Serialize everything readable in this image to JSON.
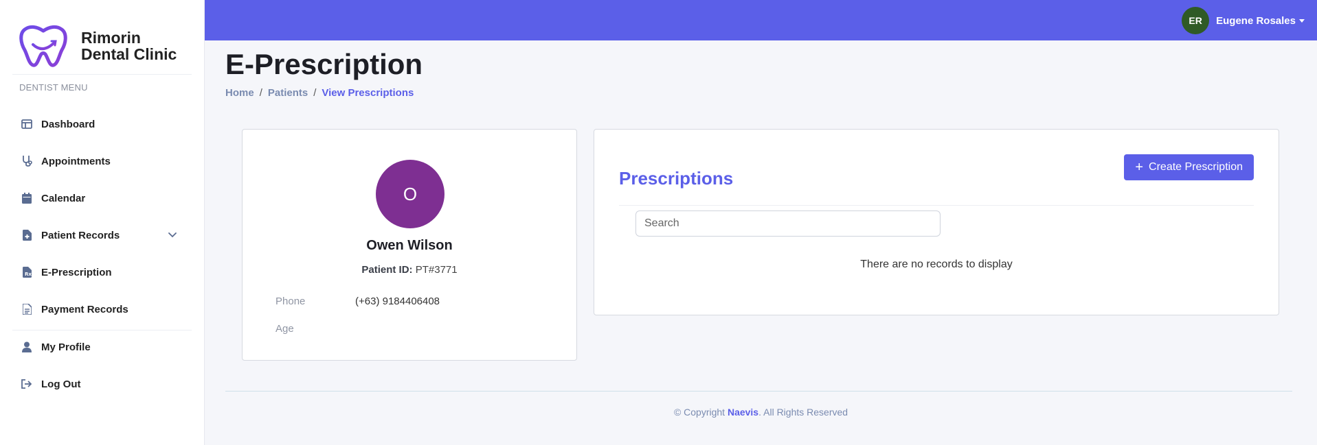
{
  "brand": {
    "name_line1": "Rimorin",
    "name_line2": "Dental Clinic"
  },
  "sidebar": {
    "heading": "DENTIST MENU",
    "items": [
      {
        "label": "Dashboard",
        "icon": "dashboard-icon"
      },
      {
        "label": "Appointments",
        "icon": "stethoscope-icon"
      },
      {
        "label": "Calendar",
        "icon": "calendar-icon"
      },
      {
        "label": "Patient Records",
        "icon": "file-medical-icon"
      },
      {
        "label": "E-Prescription",
        "icon": "prescription-icon"
      },
      {
        "label": "Payment Records",
        "icon": "document-icon"
      },
      {
        "label": "My Profile",
        "icon": "user-icon"
      },
      {
        "label": "Log Out",
        "icon": "logout-icon"
      }
    ]
  },
  "topbar": {
    "user_initials": "ER",
    "user_name": "Eugene Rosales"
  },
  "header": {
    "title": "E-Prescription",
    "breadcrumb": [
      "Home",
      "Patients",
      "View Prescriptions"
    ]
  },
  "patient": {
    "initial": "O",
    "name": "Owen Wilson",
    "id_label": "Patient ID:",
    "id_value": "PT#3771",
    "phone_label": "Phone",
    "phone_value": "(+63) 9184406408",
    "age_label": "Age",
    "age_value": ""
  },
  "prescriptions": {
    "title": "Prescriptions",
    "create_label": "Create Prescription",
    "search_placeholder": "Search",
    "empty_message": "There are no records to display"
  },
  "footer": {
    "prefix": "© Copyright ",
    "brand": "Naevis",
    "suffix": ". All Rights Reserved"
  },
  "colors": {
    "accent": "#5b5fe8",
    "patient_avatar": "#7e2f92",
    "user_avatar": "#2f5a26"
  }
}
